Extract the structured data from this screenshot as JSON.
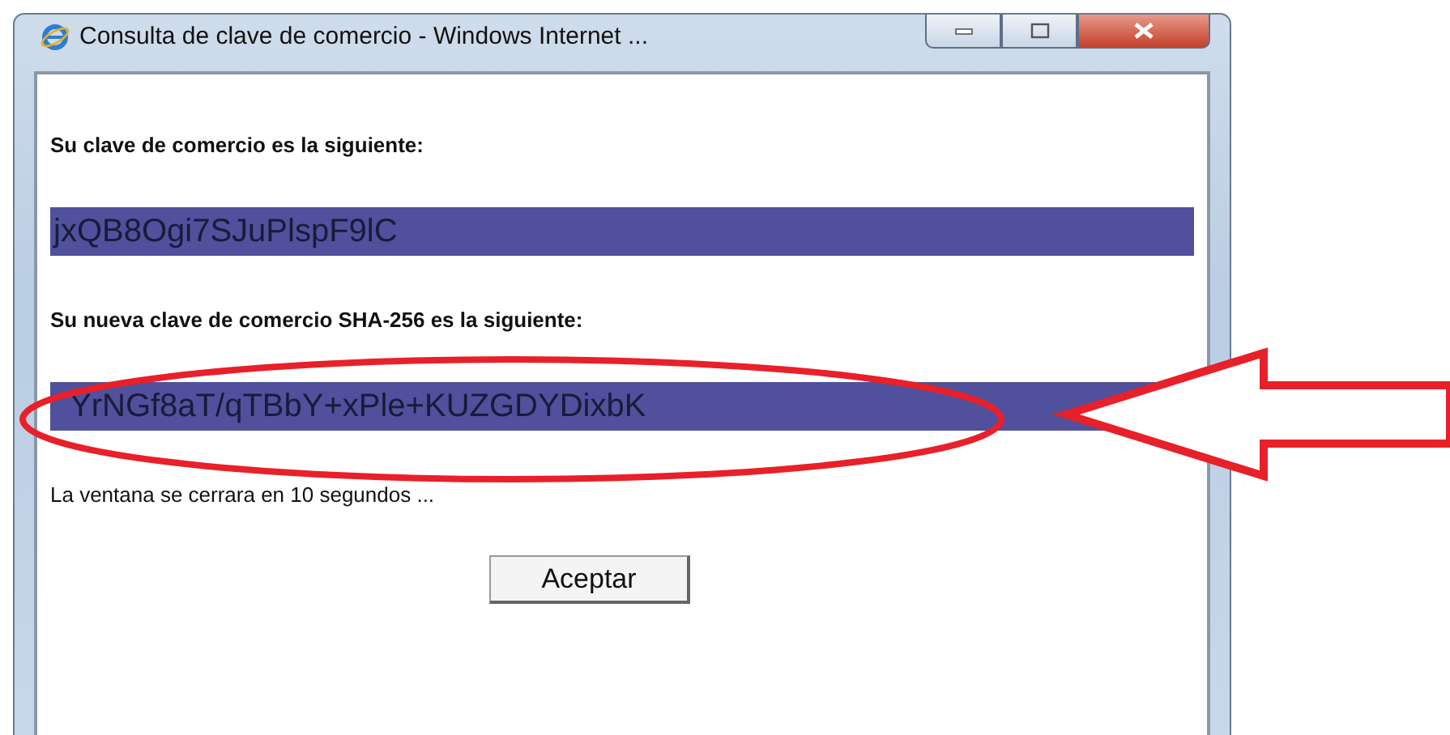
{
  "window": {
    "title": "Consulta de clave de comercio - Windows Internet ...",
    "controls": [
      {
        "kind": "minimize"
      },
      {
        "kind": "maximize"
      },
      {
        "kind": "close"
      }
    ]
  },
  "content": [
    {
      "kind": "label",
      "text": "Su clave de comercio es la siguiente:"
    },
    {
      "kind": "key",
      "text": "jxQB8Ogi7SJuPlspF9lC"
    },
    {
      "kind": "label",
      "text": "Su nueva clave de comercio SHA-256 es la siguiente:"
    },
    {
      "kind": "key",
      "text": "YrNGf8aT/qTBbY+xPle+KUZGDYDixbK"
    },
    {
      "kind": "note",
      "text": "La ventana se cerrara en 10 segundos ..."
    }
  ],
  "buttons": [
    "Aceptar"
  ],
  "annotations": [
    {
      "kind": "ellipse"
    },
    {
      "kind": "arrow"
    }
  ]
}
